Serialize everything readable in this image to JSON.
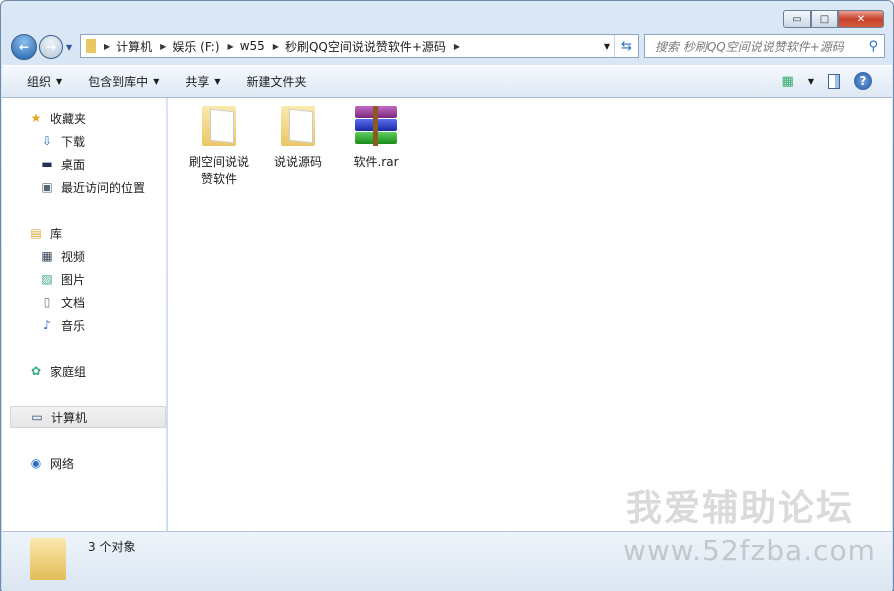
{
  "window": {
    "minimize": "▭",
    "maximize": "□",
    "close": "✕"
  },
  "address": {
    "segments": [
      "计算机",
      "娱乐 (F:)",
      "w55",
      "秒刷QQ空间说说赞软件+源码"
    ]
  },
  "search": {
    "placeholder": "搜索 秒刷QQ空间说说赞软件+源码"
  },
  "toolbar": {
    "organize": "组织",
    "include_library": "包含到库中",
    "share": "共享",
    "new_folder": "新建文件夹"
  },
  "sidebar": {
    "favorites": "收藏夹",
    "fav_items": [
      "下载",
      "桌面",
      "最近访问的位置"
    ],
    "libraries": "库",
    "lib_items": [
      "视频",
      "图片",
      "文档",
      "音乐"
    ],
    "homegroup": "家庭组",
    "computer": "计算机",
    "network": "网络"
  },
  "files": [
    {
      "name_line1": "刷空间说说",
      "name_line2": "赞软件",
      "type": "folder"
    },
    {
      "name_line1": "说说源码",
      "name_line2": "",
      "type": "folder"
    },
    {
      "name_line1": "软件.rar",
      "name_line2": "",
      "type": "rar"
    }
  ],
  "status": {
    "count": "3 个对象"
  },
  "watermark": {
    "line1": "我爱辅助论坛",
    "line2": "www.52fzba.com"
  }
}
